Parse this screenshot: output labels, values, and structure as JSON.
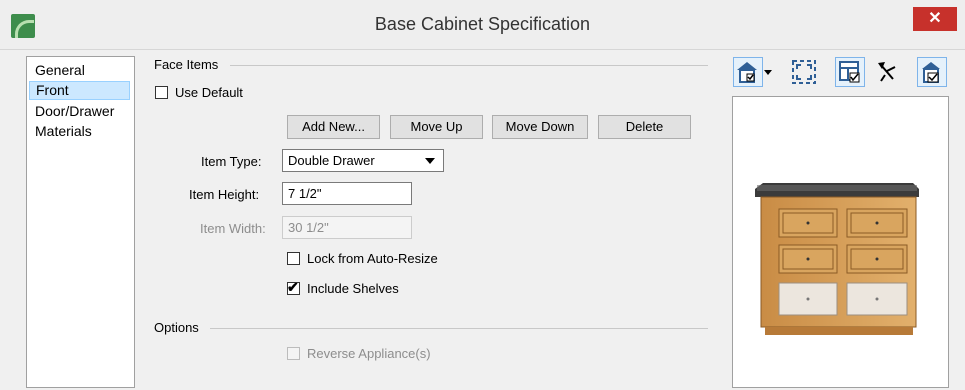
{
  "window": {
    "title": "Base Cabinet Specification",
    "close_glyph": "✕"
  },
  "sidebar": {
    "items": [
      {
        "label": "General",
        "selected": false
      },
      {
        "label": "Front",
        "selected": true
      },
      {
        "label": "Door/Drawer",
        "selected": false
      },
      {
        "label": "Materials",
        "selected": false
      }
    ]
  },
  "face_items": {
    "group_title": "Face Items",
    "use_default": {
      "label": "Use Default",
      "checked": false
    },
    "buttons": {
      "add_new": "Add New...",
      "move_up": "Move Up",
      "move_down": "Move Down",
      "delete": "Delete"
    },
    "item_type": {
      "label": "Item Type:",
      "value": "Double Drawer"
    },
    "item_height": {
      "label": "Item Height:",
      "value": "7 1/2\""
    },
    "item_width": {
      "label": "Item Width:",
      "value": "30 1/2\""
    },
    "lock_auto_resize": {
      "label": "Lock from Auto-Resize",
      "checked": false
    },
    "include_shelves": {
      "label": "Include Shelves",
      "checked": true,
      "mark": "✔"
    }
  },
  "options": {
    "group_title": "Options",
    "reverse_appliance": {
      "label": "Reverse Appliance(s)",
      "checked": false,
      "disabled": true
    }
  },
  "toolbar": {
    "icons": [
      "view-house-icon",
      "fit-to-window-icon",
      "floor-plan-icon",
      "orbit-camera-icon",
      "elevation-view-icon"
    ]
  },
  "colors": {
    "accent": "#0078d7",
    "close": "#c7312b",
    "selected_bg": "#cce8ff",
    "cabinet_wood": "#d9a55f",
    "countertop": "#3a3a3a"
  }
}
